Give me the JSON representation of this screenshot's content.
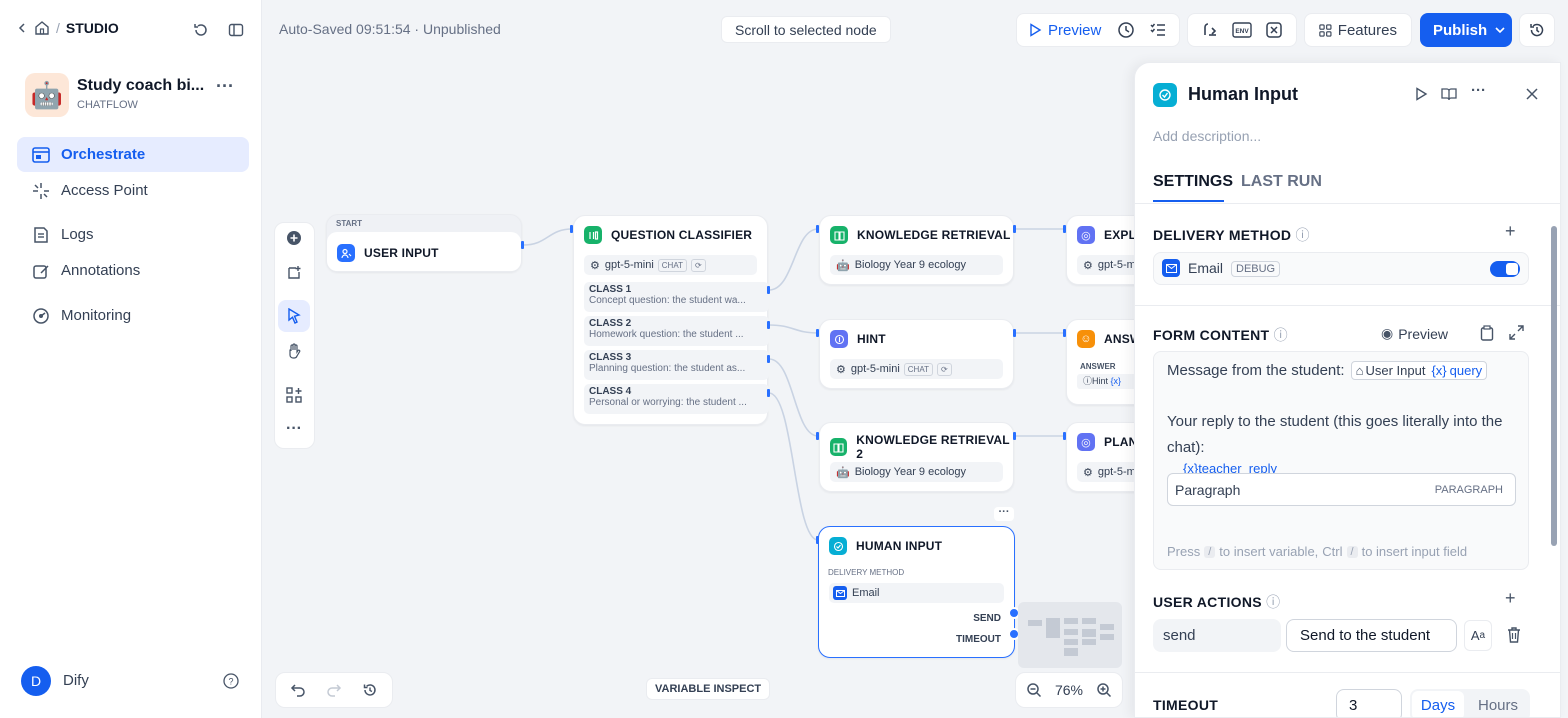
{
  "breadcrumb": {
    "studio": "STUDIO"
  },
  "app": {
    "name": "Study coach bi...",
    "type": "CHATFLOW"
  },
  "nav": [
    {
      "label": "Orchestrate"
    },
    {
      "label": "Access Point"
    },
    {
      "label": "Logs"
    },
    {
      "label": "Annotations"
    },
    {
      "label": "Monitoring"
    }
  ],
  "user": {
    "initial": "D",
    "name": "Dify"
  },
  "status": "Auto-Saved 09:51:54 · Unpublished",
  "scroll_btn": "Scroll to selected node",
  "toolbar": {
    "preview": "Preview",
    "features": "Features",
    "publish": "Publish"
  },
  "canvas": {
    "start": {
      "tag": "START",
      "title": "USER INPUT"
    },
    "qc": {
      "title": "QUESTION CLASSIFIER",
      "model": "gpt-5-mini",
      "model_tag": "CHAT",
      "classes": [
        {
          "name": "CLASS 1",
          "desc": "Concept question: the student wa..."
        },
        {
          "name": "CLASS 2",
          "desc": "Homework question: the student ..."
        },
        {
          "name": "CLASS 3",
          "desc": "Planning question: the student as..."
        },
        {
          "name": "CLASS 4",
          "desc": "Personal or worrying: the student ..."
        }
      ]
    },
    "kr1": {
      "title": "KNOWLEDGE RETRIEVAL",
      "kb": "Biology Year 9 ecology"
    },
    "hint": {
      "title": "HINT",
      "model": "gpt-5-mini",
      "model_tag": "CHAT"
    },
    "kr2": {
      "title": "KNOWLEDGE RETRIEVAL 2",
      "kb": "Biology Year 9 ecology"
    },
    "expla": {
      "title": "EXPLA",
      "model": "gpt-5-m"
    },
    "answ": {
      "title": "ANSW",
      "label": "ANSWER",
      "chip": "Hint",
      "chip_var": "{x}"
    },
    "plan": {
      "title": "PLANN",
      "model": "gpt-5-m"
    },
    "human": {
      "title": "HUMAN INPUT",
      "dm_label": "DELIVERY METHOD",
      "dm": "Email",
      "send": "SEND",
      "timeout": "TIMEOUT"
    },
    "variable_inspect": "VARIABLE INSPECT",
    "zoom": "76%"
  },
  "panel": {
    "title": "Human Input",
    "desc_placeholder": "Add description...",
    "tabs": [
      "SETTINGS",
      "LAST RUN"
    ],
    "delivery_title": "DELIVERY METHOD",
    "email": "Email",
    "debug": "DEBUG",
    "form_title": "FORM CONTENT",
    "preview": "Preview",
    "form_line1": "Message from the student:",
    "var_node": "User Input",
    "var_name": "query",
    "form_line2": "Your reply to the student (this goes literally into the chat):",
    "field_var": "teacher_reply",
    "field_value": "Paragraph",
    "field_type": "PARAGRAPH",
    "hint_press": "Press",
    "hint_key1": "/",
    "hint_mid": "to insert variable,",
    "hint_key2": "Ctrl",
    "hint_key3": "/",
    "hint_end": "to insert input field",
    "actions_title": "USER ACTIONS",
    "action_id": "send",
    "action_label": "Send to the student",
    "timeout_title": "TIMEOUT",
    "timeout_value": "3",
    "unit_days": "Days",
    "unit_hours": "Hours"
  },
  "colors": {
    "accent": "#155eef",
    "green": "#17b26a",
    "purple": "#6172f3",
    "orange": "#f79009",
    "cyan": "#06aed4",
    "blue": "#2970ff"
  }
}
